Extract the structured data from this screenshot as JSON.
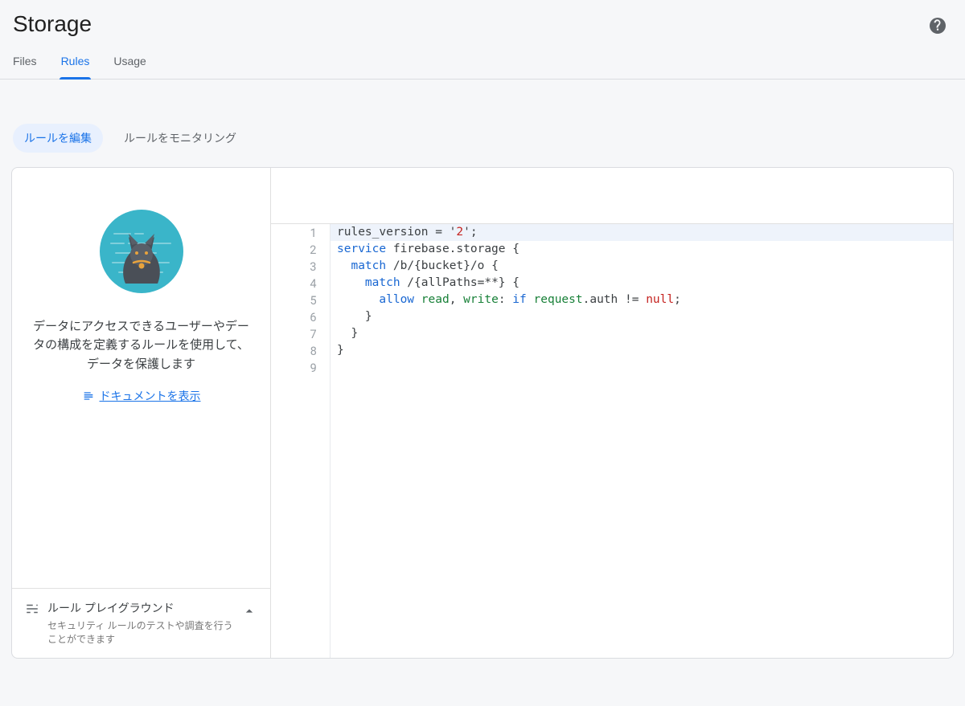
{
  "header": {
    "title": "Storage"
  },
  "tabs": {
    "items": [
      {
        "label": "Files",
        "active": false
      },
      {
        "label": "Rules",
        "active": true
      },
      {
        "label": "Usage",
        "active": false
      }
    ]
  },
  "subtabs": {
    "items": [
      {
        "label": "ルールを編集",
        "active": true
      },
      {
        "label": "ルールをモニタリング",
        "active": false
      }
    ]
  },
  "sidebar": {
    "description": "データにアクセスできるユーザーやデータの構成を定義するルールを使用して、データを保護します",
    "doc_link": "ドキュメントを表示"
  },
  "playground": {
    "title": "ルール プレイグラウンド",
    "subtitle": "セキュリティ ルールのテストや調査を行うことができます"
  },
  "editor": {
    "line_count": 9,
    "highlighted_line": 1,
    "lines": [
      "rules_version = '2';",
      "service firebase.storage {",
      "  match /b/{bucket}/o {",
      "    match /{allPaths=**} {",
      "      allow read, write: if request.auth != null;",
      "    }",
      "  }",
      "}",
      ""
    ]
  }
}
